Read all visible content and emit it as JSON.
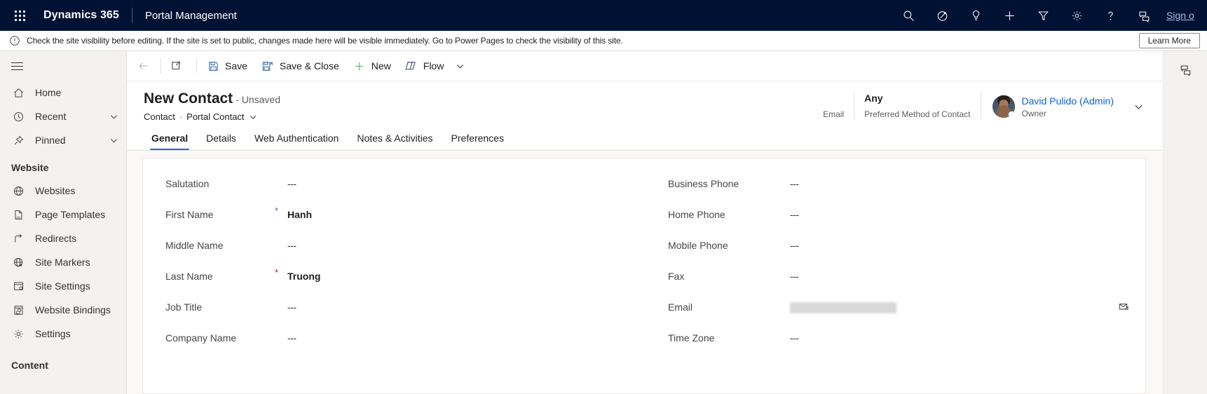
{
  "topbar": {
    "waffle_label": "App launcher",
    "brand": "Dynamics 365",
    "app_name": "Portal Management",
    "signout_label": "Sign o",
    "icons": [
      {
        "name": "search-icon",
        "label": "Search"
      },
      {
        "name": "assistant-icon",
        "label": "Copilot"
      },
      {
        "name": "lightbulb-icon",
        "label": "Insights"
      },
      {
        "name": "plus-icon",
        "label": "Quick create"
      },
      {
        "name": "filter-icon",
        "label": "Filter"
      },
      {
        "name": "gear-icon",
        "label": "Settings"
      },
      {
        "name": "help-icon",
        "label": "Help"
      },
      {
        "name": "feedback-icon",
        "label": "Feedback"
      }
    ]
  },
  "notification": {
    "message": "Check the site visibility before editing. If the site is set to public, changes made here will be visible immediately. Go to Power Pages to check the visibility of this site.",
    "button": "Learn More"
  },
  "sidebar": {
    "groups": [
      {
        "title": "",
        "items": [
          {
            "label": "Home",
            "icon": "home-icon",
            "chevron": false
          },
          {
            "label": "Recent",
            "icon": "clock-icon",
            "chevron": true
          },
          {
            "label": "Pinned",
            "icon": "pin-icon",
            "chevron": true
          }
        ]
      },
      {
        "title": "Website",
        "items": [
          {
            "label": "Websites",
            "icon": "globe-icon",
            "chevron": false
          },
          {
            "label": "Page Templates",
            "icon": "page-icon",
            "chevron": false
          },
          {
            "label": "Redirects",
            "icon": "redirect-arrow-icon",
            "chevron": false
          },
          {
            "label": "Site Markers",
            "icon": "globe-star-icon",
            "chevron": false
          },
          {
            "label": "Site Settings",
            "icon": "site-settings-icon",
            "chevron": false
          },
          {
            "label": "Website Bindings",
            "icon": "website-bindings-icon",
            "chevron": false
          },
          {
            "label": "Settings",
            "icon": "gear-icon",
            "chevron": false
          }
        ]
      },
      {
        "title": "Content",
        "items": []
      }
    ]
  },
  "commandbar": {
    "back_label": "Back",
    "popout_label": "Open in new window",
    "save_label": "Save",
    "save_close_label": "Save & Close",
    "new_label": "New",
    "flow_label": "Flow",
    "overflow_label": "More commands"
  },
  "form_header": {
    "title": "New Contact",
    "unsaved": "- Unsaved",
    "entity": "Contact",
    "separator": "·",
    "form_name": "Portal Contact",
    "fields": [
      {
        "value": "",
        "label": "Email",
        "redacted": true
      },
      {
        "value": "Any",
        "label": "Preferred Method of Contact",
        "redacted": false
      }
    ],
    "owner": {
      "name": "David Pulido (Admin)",
      "role": "Owner"
    }
  },
  "tabs": [
    {
      "label": "General",
      "active": true
    },
    {
      "label": "Details",
      "active": false
    },
    {
      "label": "Web Authentication",
      "active": false
    },
    {
      "label": "Notes & Activities",
      "active": false
    },
    {
      "label": "Preferences",
      "active": false
    }
  ],
  "form": {
    "left_column": [
      {
        "label": "Salutation",
        "required": "",
        "value": "---",
        "filled": false,
        "redacted": false
      },
      {
        "label": "First Name",
        "required": "*",
        "required_color": "blue",
        "value": "Hanh",
        "filled": true,
        "redacted": false
      },
      {
        "label": "Middle Name",
        "required": "",
        "value": "---",
        "filled": false,
        "redacted": false
      },
      {
        "label": "Last Name",
        "required": "*",
        "required_color": "red",
        "value": "Truong",
        "filled": true,
        "redacted": false
      },
      {
        "label": "Job Title",
        "required": "",
        "value": "---",
        "filled": false,
        "redacted": false
      },
      {
        "label": "Company Name",
        "required": "",
        "value": "---",
        "filled": false,
        "redacted": false
      }
    ],
    "right_column": [
      {
        "label": "Business Phone",
        "required": "",
        "value": "---",
        "filled": false,
        "redacted": false,
        "end_icon": ""
      },
      {
        "label": "Home Phone",
        "required": "",
        "value": "---",
        "filled": false,
        "redacted": false,
        "end_icon": ""
      },
      {
        "label": "Mobile Phone",
        "required": "",
        "value": "---",
        "filled": false,
        "redacted": false,
        "end_icon": ""
      },
      {
        "label": "Fax",
        "required": "",
        "value": "---",
        "filled": false,
        "redacted": false,
        "end_icon": ""
      },
      {
        "label": "Email",
        "required": "",
        "value": "",
        "filled": false,
        "redacted": true,
        "end_icon": "send-email-icon"
      },
      {
        "label": "Time Zone",
        "required": "",
        "value": "---",
        "filled": false,
        "redacted": false,
        "end_icon": ""
      }
    ]
  },
  "right_rail": {
    "icons": [
      {
        "name": "chat-assistant-icon",
        "label": "Copilot chat"
      }
    ]
  },
  "colors": {
    "topbar_bg": "#001233",
    "accent": "#2266d3",
    "link": "#0f62d6",
    "required_red": "#a4262c",
    "canvas": "#faf9f8"
  }
}
